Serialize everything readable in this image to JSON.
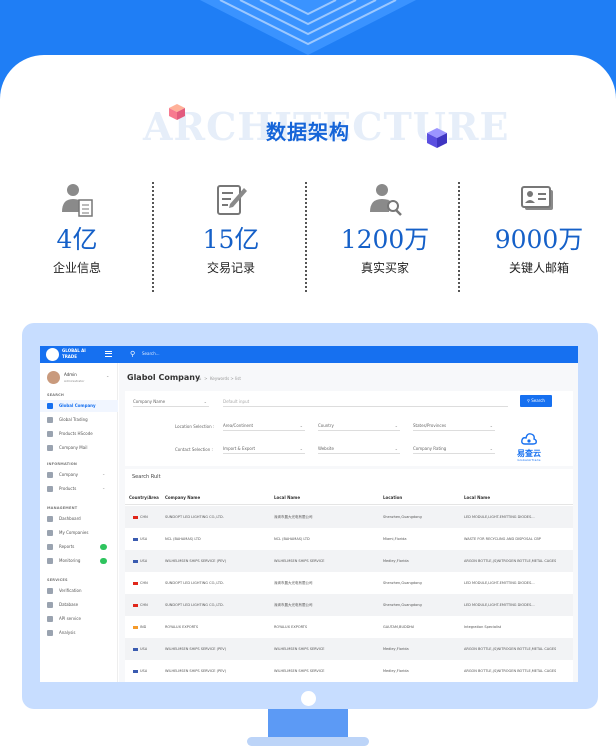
{
  "banner": {
    "background_word": "ARCHITECTURE",
    "title": "数据架构",
    "colors": {
      "blue": "#1f7ef5",
      "title_blue": "#1665d8",
      "number_blue": "#1560c8"
    }
  },
  "stats": [
    {
      "icon": "enterprise-document-icon",
      "value": "4亿",
      "label": "企业信息"
    },
    {
      "icon": "trade-record-edit-icon",
      "value": "15亿",
      "label": "交易记录"
    },
    {
      "icon": "buyer-search-icon",
      "value": "1200万",
      "label": "真实买家"
    },
    {
      "icon": "contact-card-icon",
      "value": "9000万",
      "label": "关键人邮箱"
    }
  ],
  "app": {
    "logo_text": "GLOBAL AI TRADE",
    "search_placeholder": "Search...",
    "user": {
      "name": "Admin",
      "role": "Administrator"
    },
    "sidebar": {
      "sections": [
        {
          "title": "SEARCH",
          "items": [
            {
              "label": "Global Company",
              "icon": "search-icon",
              "active": true
            },
            {
              "label": "Global Trading",
              "icon": "globe-icon"
            },
            {
              "label": "Products HScode",
              "icon": "sitemap-icon"
            },
            {
              "label": "Company Mail",
              "icon": "mail-icon"
            }
          ]
        },
        {
          "title": "INFORMATION",
          "items": [
            {
              "label": "Company",
              "icon": "globe-icon",
              "chevron": true
            },
            {
              "label": "Products",
              "icon": "box-icon",
              "chevron": true
            }
          ]
        },
        {
          "title": "MANAGEMENT",
          "items": [
            {
              "label": "Dashboard",
              "icon": "dashboard-icon"
            },
            {
              "label": "My Companies",
              "icon": "users-icon"
            },
            {
              "label": "Reports",
              "icon": "file-icon",
              "badge": true
            },
            {
              "label": "Monitoring",
              "icon": "clock-icon",
              "badge": true
            }
          ]
        },
        {
          "title": "SERVICES",
          "items": [
            {
              "label": "Verification",
              "icon": "send-icon"
            },
            {
              "label": "Database",
              "icon": "database-icon"
            },
            {
              "label": "API service",
              "icon": "cloud-icon"
            },
            {
              "label": "Analysis",
              "icon": "chart-icon"
            }
          ]
        }
      ]
    },
    "main": {
      "title": "Glabol Company",
      "breadcrumb": "Keywords  >  list",
      "form": {
        "company_name_select": "Company Name",
        "default_input_placeholder": "Default input",
        "search_button": "Search",
        "location_label": "Location Selection :",
        "location_fields": [
          "Area/Continent",
          "Country",
          "States/Provinces"
        ],
        "contact_label": "Contact Selection :",
        "contact_fields": [
          "Import & Export",
          "Website",
          "Company Rating"
        ],
        "brand_cn": "易查云",
        "brand_en": "GlobalAiTrade"
      },
      "results": {
        "title": "Search Rult",
        "columns": [
          "Country/Area",
          "Company Name",
          "Local Name",
          "Location",
          "Local Name"
        ],
        "rows": [
          {
            "flag": "china",
            "country": "CHN",
            "company": "SUNDOPT LED LIGHTING CO.,LTD.",
            "local": "深圳市晨大光电有限公司",
            "location": "Shenzhen,Guangdong",
            "product": "LED MODULE,LIGHT-EMITTING DIODES..."
          },
          {
            "flag": "usa",
            "country": "USA",
            "company": "NCL (BAHAMAS) LTD",
            "local": "NCL (BAHAMAS) LTD",
            "location": "Miami,Florida",
            "product": "WASTE FOR RECYCLING AND DISPOSAL CBP"
          },
          {
            "flag": "usa",
            "country": "USA",
            "company": "WILHELMSEN SHIPS SERVICE (PEV)",
            "local": "WILHELMSEN SHIPS SERVICE",
            "location": "Medley,Florida",
            "product": "ARGON BOTTLE,(S)NITROGEN BOTTLE,METAL CAGES"
          },
          {
            "flag": "china",
            "country": "CHN",
            "company": "SUNDOPT LED LIGHTING CO.,LTD.",
            "local": "深圳市晨大光电有限公司",
            "location": "Shenzhen,Guangdong",
            "product": "LED MODULE,LIGHT-EMITTING DIODES..."
          },
          {
            "flag": "china",
            "country": "CHN",
            "company": "SUNDOPT LED LIGHTING CO.,LTD.",
            "local": "深圳市晨大光电有限公司",
            "location": "Shenzhen,Guangdong",
            "product": "LED MODULE,LIGHT-EMITTING DIODES..."
          },
          {
            "flag": "india",
            "country": "IND",
            "company": "ROYALUX EXPORTS",
            "local": "ROYALUX EXPORTS",
            "location": "GAUTAM,BUDDHA",
            "product": "Integration Specialist"
          },
          {
            "flag": "usa",
            "country": "USA",
            "company": "WILHELMSEN SHIPS SERVICE (PEV)",
            "local": "WILHELMSEN SHIPS SERVICE",
            "location": "Medley,Florida",
            "product": "ARGON BOTTLE,(S)NITROGEN BOTTLE,METAL CAGES"
          },
          {
            "flag": "usa",
            "country": "USA",
            "company": "WILHELMSEN SHIPS SERVICE (PEV)",
            "local": "WILHELMSEN SHIPS SERVICE",
            "location": "Medley,Florida",
            "product": "ARGON BOTTLE,(S)NITROGEN BOTTLE,METAL CAGES"
          }
        ]
      }
    }
  }
}
